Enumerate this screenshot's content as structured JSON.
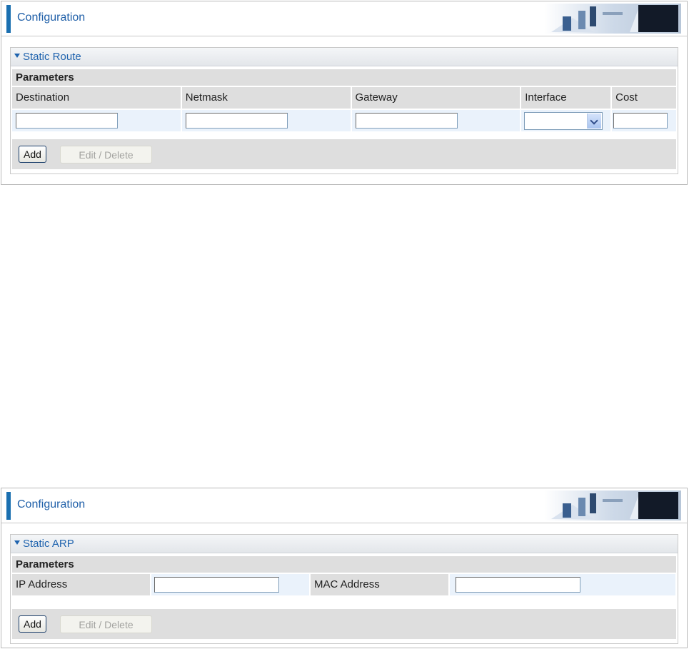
{
  "top_panel": {
    "header_title": "Configuration",
    "section_title": "Static Route",
    "params_label": "Parameters",
    "columns": [
      "Destination",
      "Netmask",
      "Gateway",
      "Interface",
      "Cost"
    ],
    "destination_value": "",
    "netmask_value": "",
    "gateway_value": "",
    "interface_selected": "",
    "cost_value": "",
    "add_label": "Add",
    "edit_delete_label": "Edit / Delete"
  },
  "bottom_panel": {
    "header_title": "Configuration",
    "section_title": "Static ARP",
    "params_label": "Parameters",
    "ip_label": "IP Address",
    "ip_value": "",
    "mac_label": "MAC Address",
    "mac_value": "",
    "add_label": "Add",
    "edit_delete_label": "Edit / Delete"
  },
  "colors": {
    "accent": "#1f63ae",
    "header_bar": "#1a6fb0",
    "label_bg": "#dedede",
    "input_cell_bg": "#eaf2fb"
  }
}
